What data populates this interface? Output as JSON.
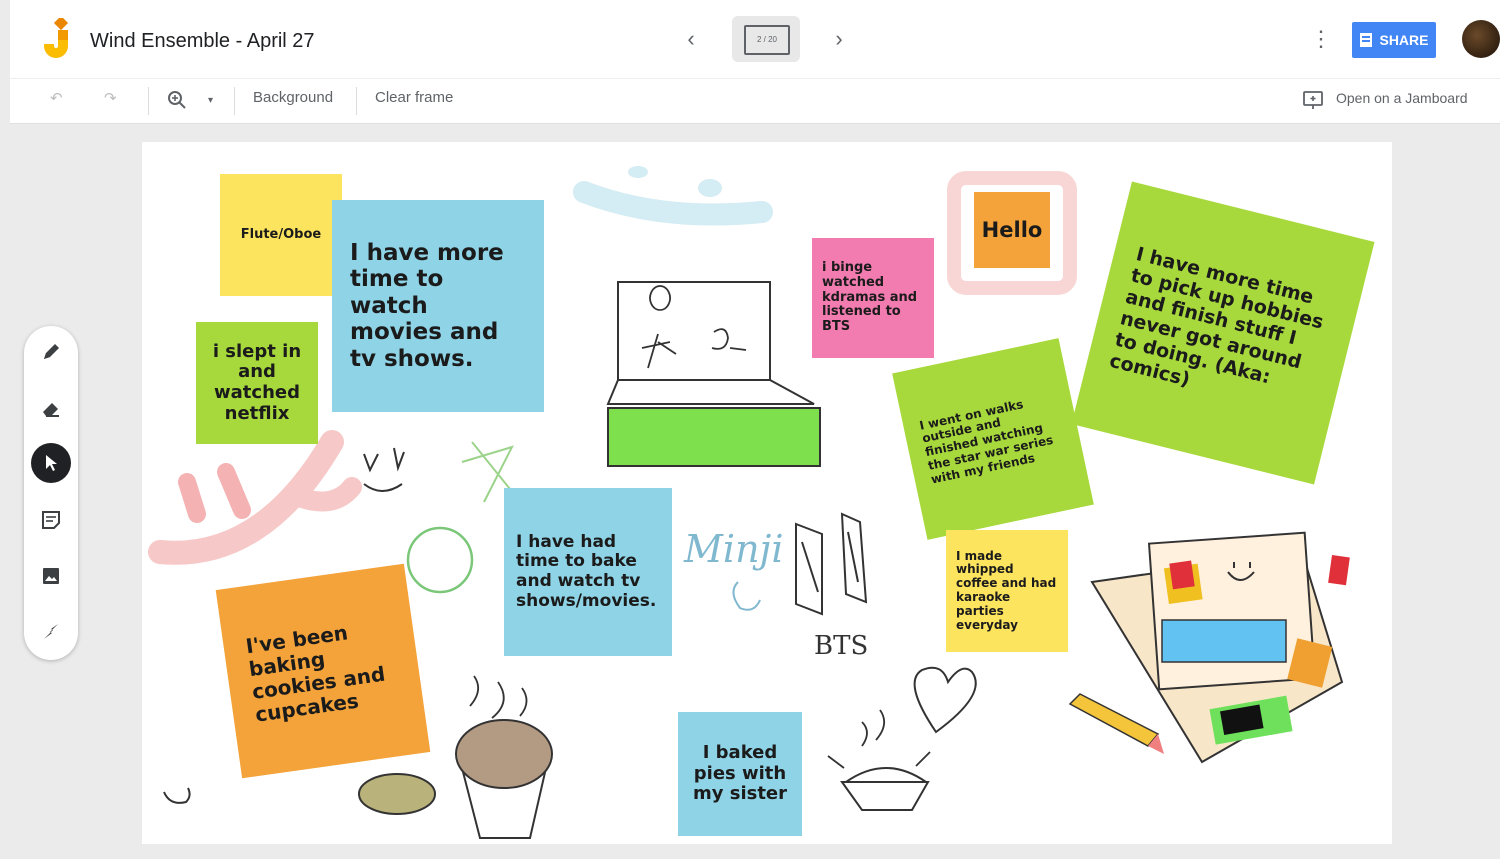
{
  "app": {
    "title": "Wind Ensemble - April 27",
    "frame_indicator": "2 / 20",
    "share_label": "SHARE"
  },
  "toolbar": {
    "background_label": "Background",
    "clear_frame_label": "Clear frame",
    "open_jamboard_label": "Open on a Jamboard"
  },
  "colors": {
    "yellow": "#fde45f",
    "blue": "#8fd3e6",
    "green": "#a8d93c",
    "pink": "#f27bb0",
    "orange": "#f3a33a",
    "share": "#4285f4"
  },
  "notes": [
    {
      "text": "Flute/Oboe"
    },
    {
      "text": "I have more time to watch movies and tv shows."
    },
    {
      "text": "i slept in and watched netflix"
    },
    {
      "text": "i binge watched kdramas and listened to BTS"
    },
    {
      "text": "Hello"
    },
    {
      "text": "I have more time to pick up hobbies and finish stuff I never got around to doing. (Aka: comics)"
    },
    {
      "text": "I went on walks outside and finished watching the star war series with my friends"
    },
    {
      "text": "I have had time to bake and watch tv shows/movies."
    },
    {
      "text": "I made whipped coffee and had karaoke parties everyday"
    },
    {
      "text": "I've been baking cookies and cupcakes"
    },
    {
      "text": "I baked pies with my sister"
    }
  ],
  "handwriting": {
    "minji": "Minji",
    "bts": "BTS"
  }
}
